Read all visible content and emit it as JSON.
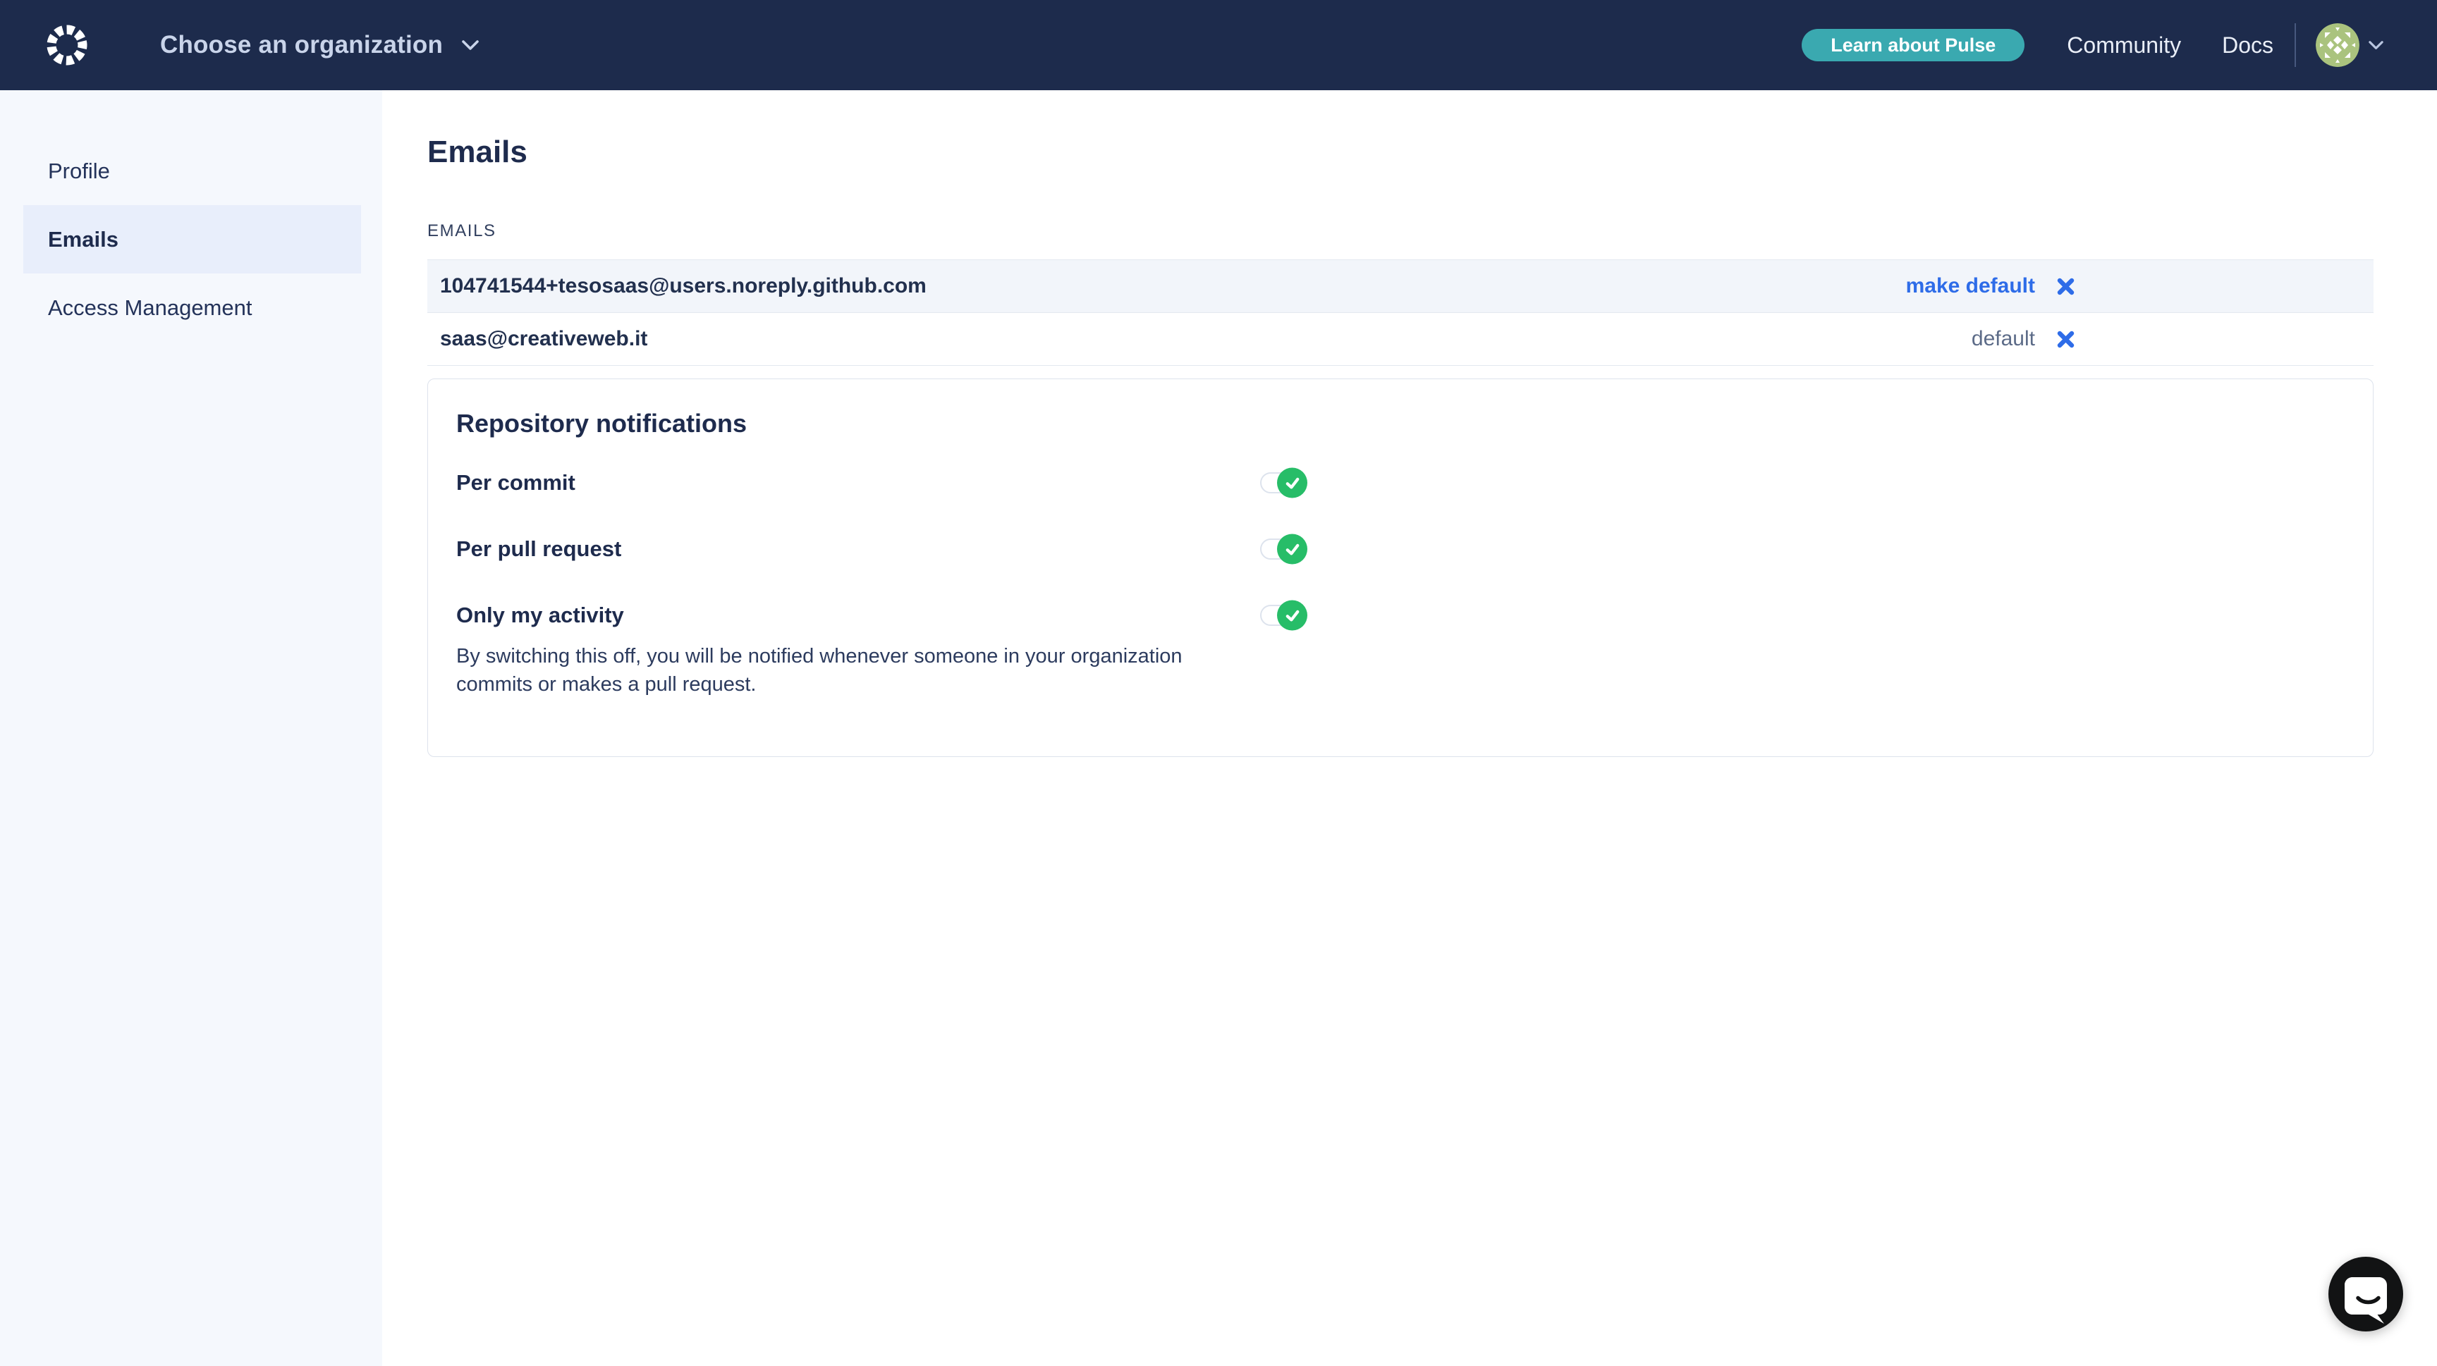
{
  "header": {
    "org_selector_label": "Choose an organization",
    "learn_button_label": "Learn about Pulse",
    "nav_links": [
      {
        "label": "Community"
      },
      {
        "label": "Docs"
      }
    ],
    "icons": {
      "brand_logo": "dashed-circle-pulse-logo",
      "org_chevron": "chevron-down",
      "avatar": "green-identicon",
      "avatar_caret": "chevron-down"
    }
  },
  "sidebar": {
    "items": [
      {
        "label": "Profile",
        "active": false
      },
      {
        "label": "Emails",
        "active": true
      },
      {
        "label": "Access Management",
        "active": false
      }
    ]
  },
  "main": {
    "title": "Emails",
    "emails_section": {
      "label": "EMAILS",
      "rows": [
        {
          "email": "104741544+tesosaas@users.noreply.github.com",
          "action_label": "make default",
          "action_type": "link",
          "remove_icon": "x-icon"
        },
        {
          "email": "saas@creativeweb.it",
          "action_label": "default",
          "action_type": "static",
          "remove_icon": "x-icon"
        }
      ]
    },
    "notifications_panel": {
      "title": "Repository notifications",
      "toggles": [
        {
          "label": "Per commit",
          "enabled": true
        },
        {
          "label": "Per pull request",
          "enabled": true
        },
        {
          "label": "Only my activity",
          "enabled": true,
          "description": "By switching this off, you will be notified whenever someone in your organization commits or makes a pull request."
        }
      ],
      "toggle_icon": "check-icon"
    }
  },
  "chat_launcher": {
    "icon": "chat-bubble-smile"
  },
  "colors": {
    "topbar_bg": "#1d2b4c",
    "teal_button": "#3aa9b0",
    "link_blue": "#2e6ce8",
    "toggle_green": "#27bd68",
    "sidebar_bg": "#f5f8fd",
    "sidebar_active_bg": "#e8eefb",
    "row_highlight_bg": "#f2f5fa",
    "row_border": "#e3e8f0",
    "heading_text": "#1e2b4d",
    "muted_text": "#5c6b88"
  }
}
